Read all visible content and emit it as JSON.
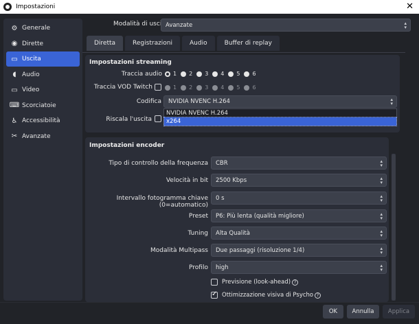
{
  "window": {
    "title": "Impostazioni",
    "close_glyph": "✕"
  },
  "sidebar": {
    "items": [
      {
        "label": "Generale",
        "icon": "gear-icon",
        "glyph": "⚙"
      },
      {
        "label": "Dirette",
        "icon": "broadcast-icon",
        "glyph": "◉"
      },
      {
        "label": "Uscita",
        "icon": "output-icon",
        "glyph": "▭",
        "active": true
      },
      {
        "label": "Audio",
        "icon": "speaker-icon",
        "glyph": "◖"
      },
      {
        "label": "Video",
        "icon": "monitor-icon",
        "glyph": "▭"
      },
      {
        "label": "Scorciatoie",
        "icon": "keyboard-icon",
        "glyph": "⌨"
      },
      {
        "label": "Accessibilità",
        "icon": "accessibility-icon",
        "glyph": "♿"
      },
      {
        "label": "Avanzate",
        "icon": "tools-icon",
        "glyph": "✂"
      }
    ]
  },
  "output_mode": {
    "label": "Modalità di uscita",
    "value": "Avanzate"
  },
  "tabs": [
    "Diretta",
    "Registrazioni",
    "Audio",
    "Buffer di replay"
  ],
  "streaming": {
    "title": "Impostazioni streaming",
    "audio_track_label": "Traccia audio",
    "vod_track_label": "Traccia VOD Twitch",
    "tracks": [
      "1",
      "2",
      "3",
      "4",
      "5",
      "6"
    ],
    "encoder_label": "Codifica",
    "encoder_value": "NVIDIA NVENC H.264",
    "encoder_options": [
      "NVIDIA NVENC H.264",
      "x264"
    ],
    "rescale_label": "Riscala l'uscita"
  },
  "encoder": {
    "title": "Impostazioni encoder",
    "rows": [
      {
        "label": "Tipo di controllo della frequenza",
        "value": "CBR"
      },
      {
        "label": "Velocità in bit",
        "value": "2500 Kbps"
      },
      {
        "label": "Intervallo fotogramma chiave (0=automatico)",
        "value": "0 s"
      },
      {
        "label": "Preset",
        "value": "P6: Più lenta (qualità migliore)"
      },
      {
        "label": "Tuning",
        "value": "Alta Qualità"
      },
      {
        "label": "Modalità Multipass",
        "value": "Due passaggi (risoluzione 1/4)"
      },
      {
        "label": "Profilo",
        "value": "high"
      }
    ],
    "lookahead_label": "Previsione (look-ahead)",
    "psycho_label": "Ottimizzazione visiva di Psycho"
  },
  "buttons": {
    "ok": "OK",
    "cancel": "Annulla",
    "apply": "Applica"
  },
  "colors": {
    "accent": "#3a64d6",
    "background": "#212328",
    "panel": "#2b2e38"
  }
}
